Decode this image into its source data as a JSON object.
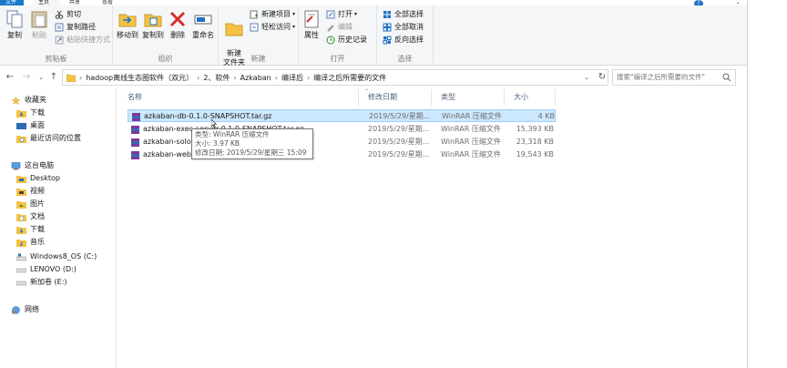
{
  "ribbon_tabs": {
    "file": "文件",
    "home": "主页",
    "share": "共享",
    "view": "查看"
  },
  "clipboard": {
    "copy": "复制",
    "paste": "粘贴",
    "cut": "剪切",
    "copy_path": "复制路径",
    "paste_shortcut": "粘贴快捷方式",
    "label": "剪贴板"
  },
  "organize": {
    "move_to": "移动到",
    "copy_to": "复制到",
    "delete": "删除",
    "rename": "重命名",
    "label": "组织"
  },
  "new_group": {
    "new_folder": "新建\n文件夹",
    "new_item": "新建项目",
    "easy_access": "轻松访问",
    "label": "新建"
  },
  "open_group": {
    "properties": "属性",
    "open": "打开",
    "edit": "编辑",
    "history": "历史记录",
    "label": "打开"
  },
  "select_group": {
    "select_all": "全部选择",
    "select_none": "全部取消",
    "invert": "反向选择",
    "label": "选择"
  },
  "address": {
    "crumbs": [
      "hadoop离线生态圈软件（双元）",
      "2、软件",
      "Azkaban",
      "编译后",
      "编译之后所需要的文件"
    ],
    "search_placeholder": "搜索\"编译之后所需要的文件\""
  },
  "sidebar": {
    "quick_access": "收藏夹",
    "downloads": "下载",
    "desktop": "桌面",
    "recent": "最近访问的位置",
    "this_pc": "这台电脑",
    "pc_desktop": "Desktop",
    "videos": "视频",
    "pictures": "图片",
    "documents": "文档",
    "pc_downloads": "下载",
    "music": "音乐",
    "drive_c": "Windows8_OS (C:)",
    "drive_d": "LENOVO (D:)",
    "drive_e": "新加卷 (E:)",
    "network": "网络"
  },
  "columns": {
    "name": "名称",
    "date": "修改日期",
    "type": "类型",
    "size": "大小"
  },
  "files": [
    {
      "name": "azkaban-db-0.1.0-SNAPSHOT.tar.gz",
      "date": "2019/5/29/星期...",
      "type": "WinRAR 压缩文件",
      "size": "4 KB"
    },
    {
      "name": "azkaban-exec-server-0.1.0-SNAPSHOT.tar.gz",
      "date": "2019/5/29/星期...",
      "type": "WinRAR 压缩文件",
      "size": "15,393 KB"
    },
    {
      "name": "azkaban-solo-server-0.1.0-SNAPSHOT.tar.gz",
      "date": "2019/5/29/星期...",
      "type": "WinRAR 压缩文件",
      "size": "23,318 KB"
    },
    {
      "name": "azkaban-web-server-0.1.0-SNAPSHOT.tar.gz",
      "date": "2019/5/29/星期...",
      "type": "WinRAR 压缩文件",
      "size": "19,543 KB"
    }
  ],
  "tooltip": {
    "type_line": "类型: WinRAR 压缩文件",
    "size_line": "大小: 3.97 KB",
    "date_line": "修改日期: 2019/5/29/星期三 15:09"
  },
  "colors": {
    "accent": "#1979ca",
    "selection": "#cce8ff",
    "folder": "#f5c242"
  },
  "window": {
    "help": "?",
    "close": "×"
  }
}
